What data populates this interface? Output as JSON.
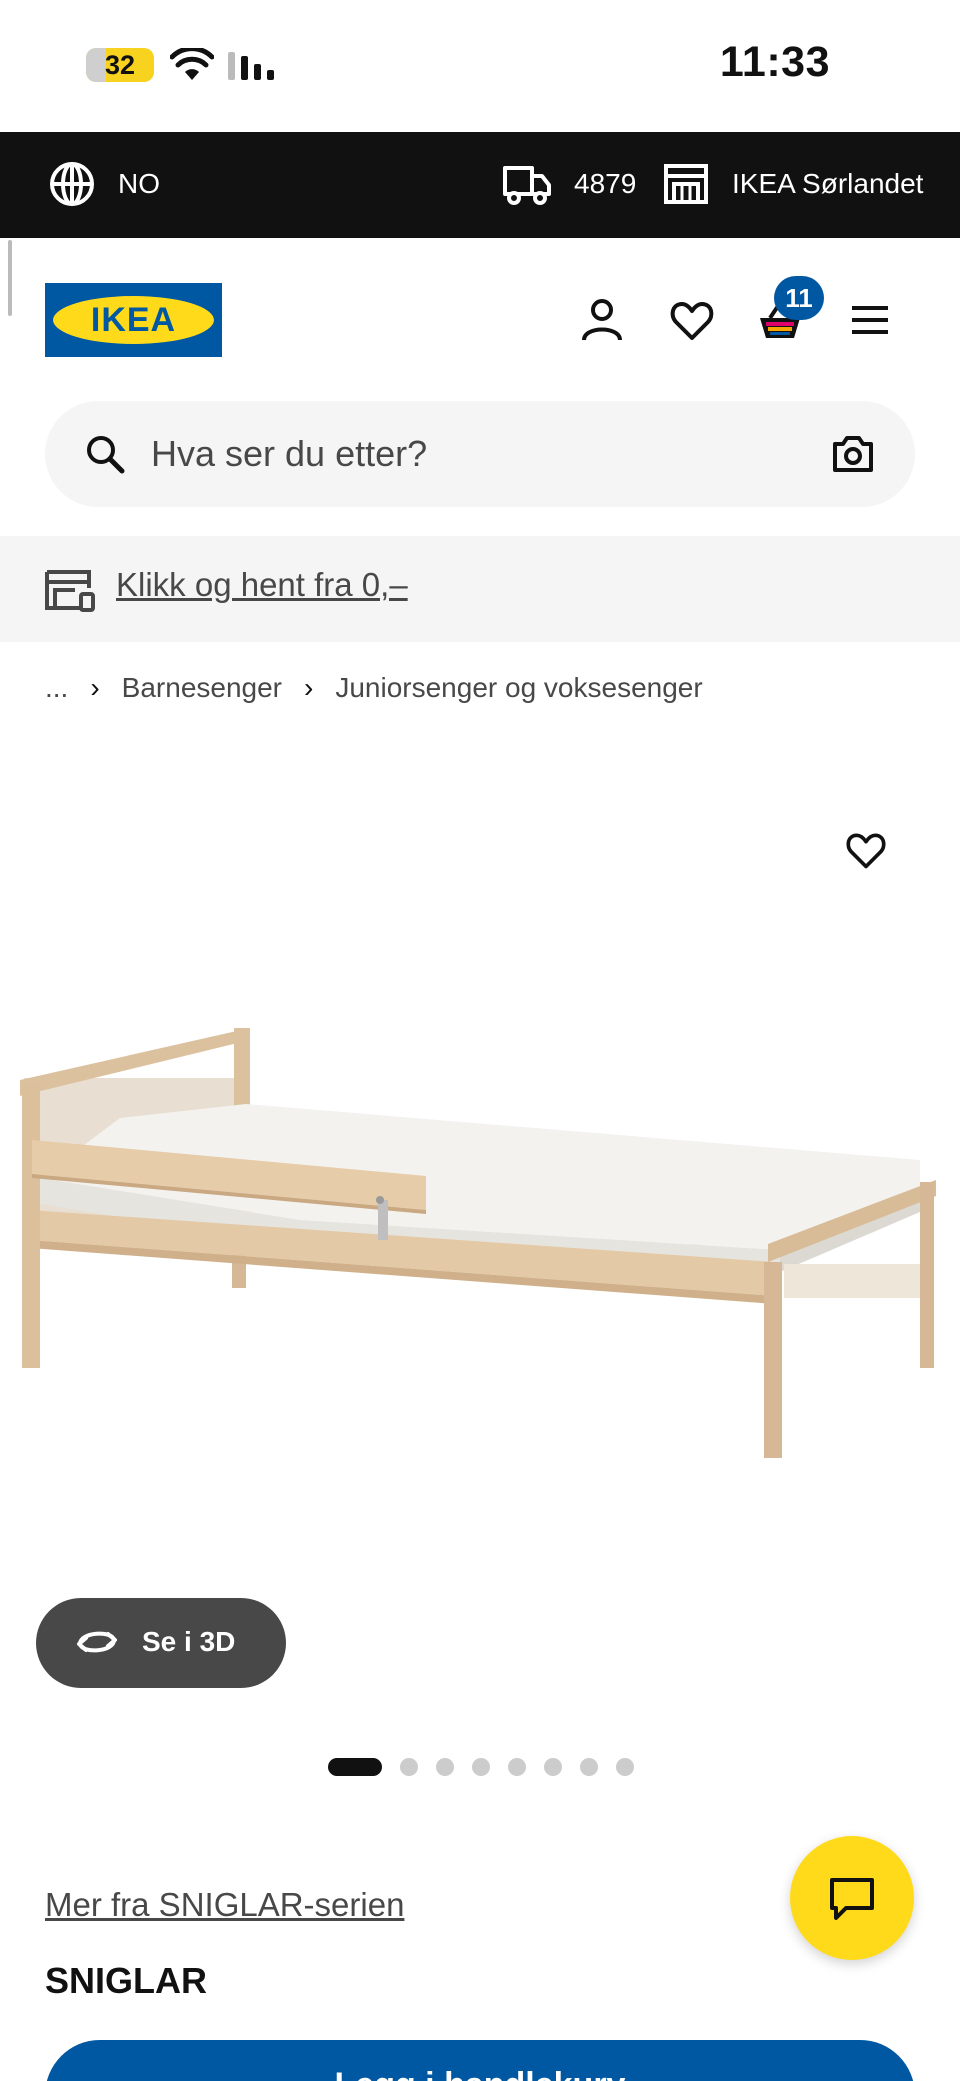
{
  "status_bar": {
    "battery": "32",
    "time": "11:33"
  },
  "top_bar": {
    "language": "NO",
    "postcode": "4879",
    "store": "IKEA Sørlandet"
  },
  "header": {
    "logo_text": "IKEA",
    "cart_count": "11"
  },
  "search": {
    "placeholder": "Hva ser du etter?"
  },
  "promo": {
    "text": "Klikk og hent fra 0,–"
  },
  "breadcrumb": {
    "ellipsis": "...",
    "items": [
      "Barnesenger",
      "Juniorsenger og voksesenger"
    ]
  },
  "product": {
    "view_3d_label": "Se i 3D",
    "image_count": 8,
    "active_image": 1,
    "series_link": "Mer fra SNIGLAR-serien",
    "name": "SNIGLAR",
    "add_to_cart_label": "Legg i handlekurv"
  },
  "colors": {
    "ikea_blue": "#0058a3",
    "ikea_yellow": "#ffda1a",
    "dark": "#111111"
  },
  "icons": [
    "globe-icon",
    "truck-icon",
    "store-icon",
    "account-icon",
    "heart-icon",
    "basket-icon",
    "menu-icon",
    "search-icon",
    "camera-icon",
    "click-collect-icon",
    "rotate-3d-icon",
    "chat-icon"
  ]
}
